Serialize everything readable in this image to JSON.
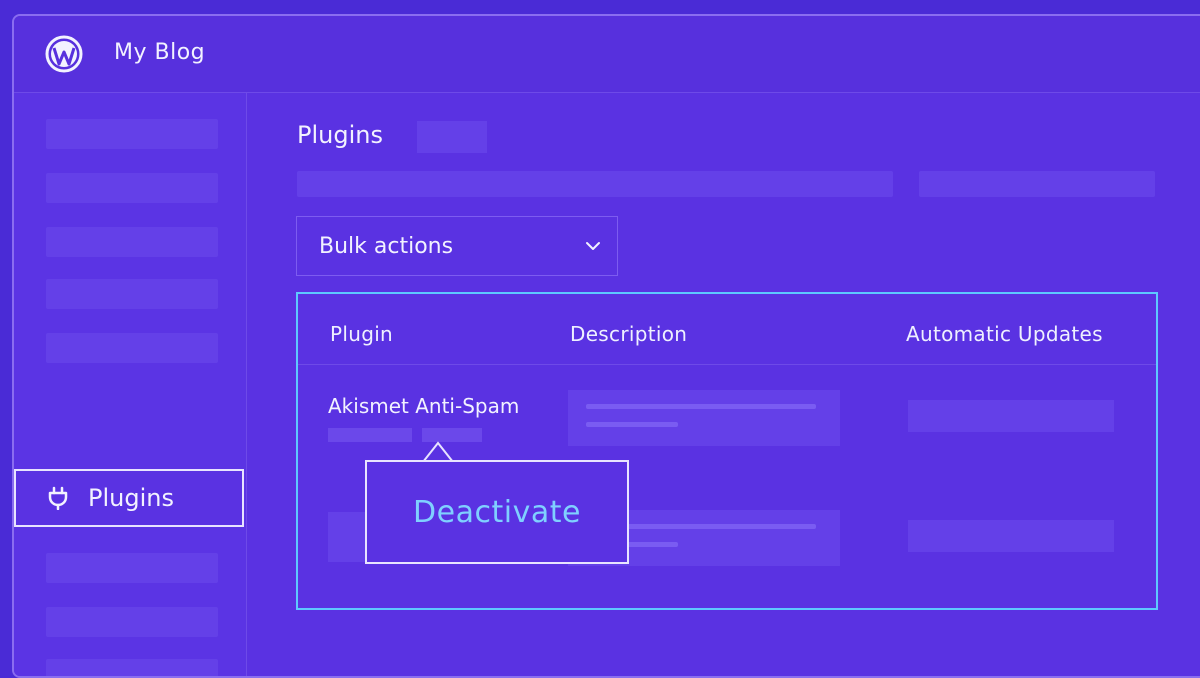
{
  "header": {
    "site_title": "My Blog",
    "logo_icon": "wordpress-logo-icon"
  },
  "sidebar": {
    "active_item": {
      "label": "Plugins",
      "icon": "plug-icon"
    }
  },
  "main": {
    "page_title": "Plugins",
    "bulk_actions": {
      "selected": "Bulk actions",
      "icon": "chevron-down-icon"
    },
    "table": {
      "headers": [
        "Plugin",
        "Description",
        "Automatic Updates"
      ],
      "rows": [
        {
          "name": "Akismet Anti-Spam"
        }
      ]
    }
  },
  "tooltip": {
    "label": "Deactivate"
  },
  "colors": {
    "background": "#4a2bd6",
    "panel": "#5a32e2",
    "accent_border": "#5ec8ff",
    "tooltip_text": "#7fd0ff"
  }
}
